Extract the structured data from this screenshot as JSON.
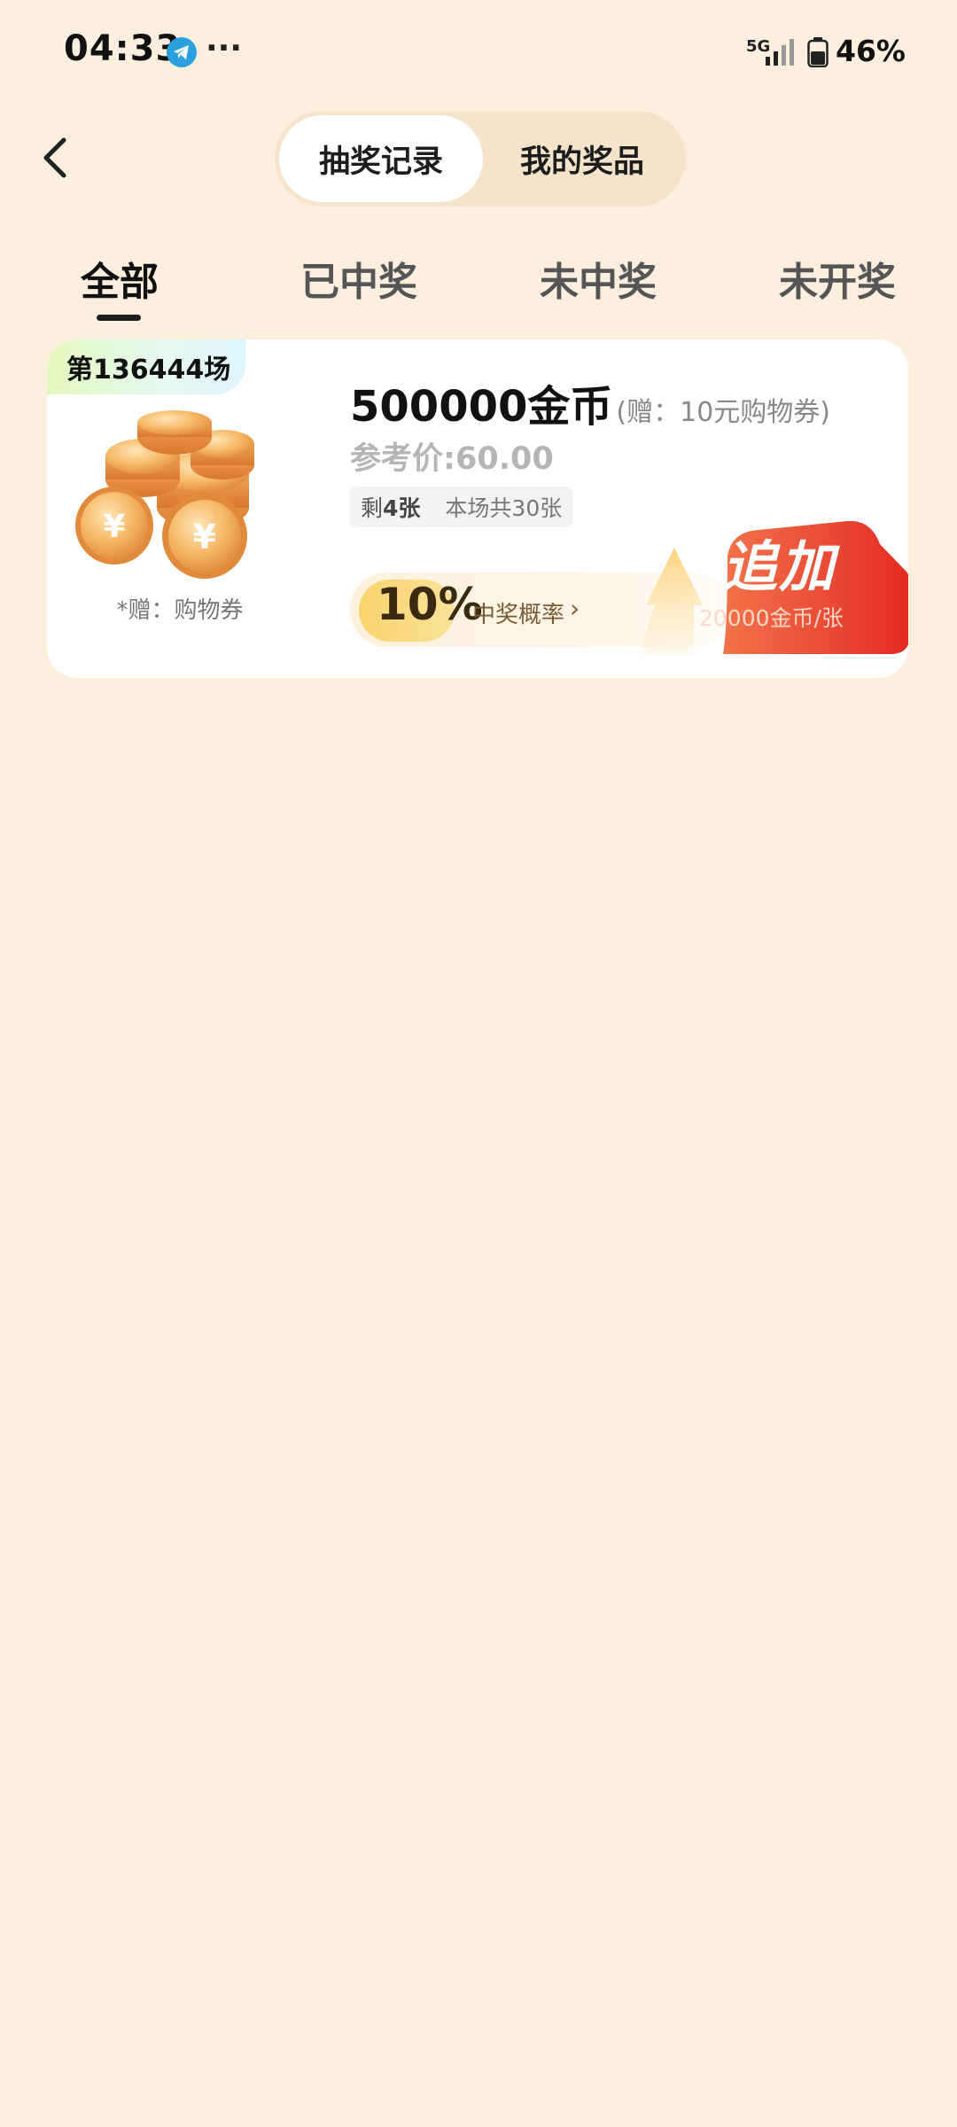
{
  "status": {
    "time": "04:33",
    "app_icon": "telegram-icon",
    "more": "···",
    "network": "5G",
    "battery": "46%"
  },
  "header": {
    "back_icon": "chevron-left-icon",
    "segments": [
      "抽奖记录",
      "我的奖品"
    ],
    "active_segment": "抽奖记录"
  },
  "tabs": {
    "items": [
      "全部",
      "已中奖",
      "未中奖",
      "未开奖"
    ],
    "active": "全部"
  },
  "record": {
    "round": "第136444场",
    "prize_title": "500000金币",
    "prize_bonus": "(赠：10元购物券)",
    "gift_note": "*赠：购物券",
    "reference_price": "参考价:60.00",
    "remaining_prefix": "剩",
    "remaining_count": "4张",
    "total": "本场共30张",
    "probability": "10%",
    "probability_label": "中奖概率",
    "probability_arrow": "›",
    "add_label": "追加",
    "add_price": "20000金币/张"
  },
  "colors": {
    "background": "#FCEFDD",
    "accent_red": "#EE3B2A",
    "gold": "#F8D46B"
  }
}
